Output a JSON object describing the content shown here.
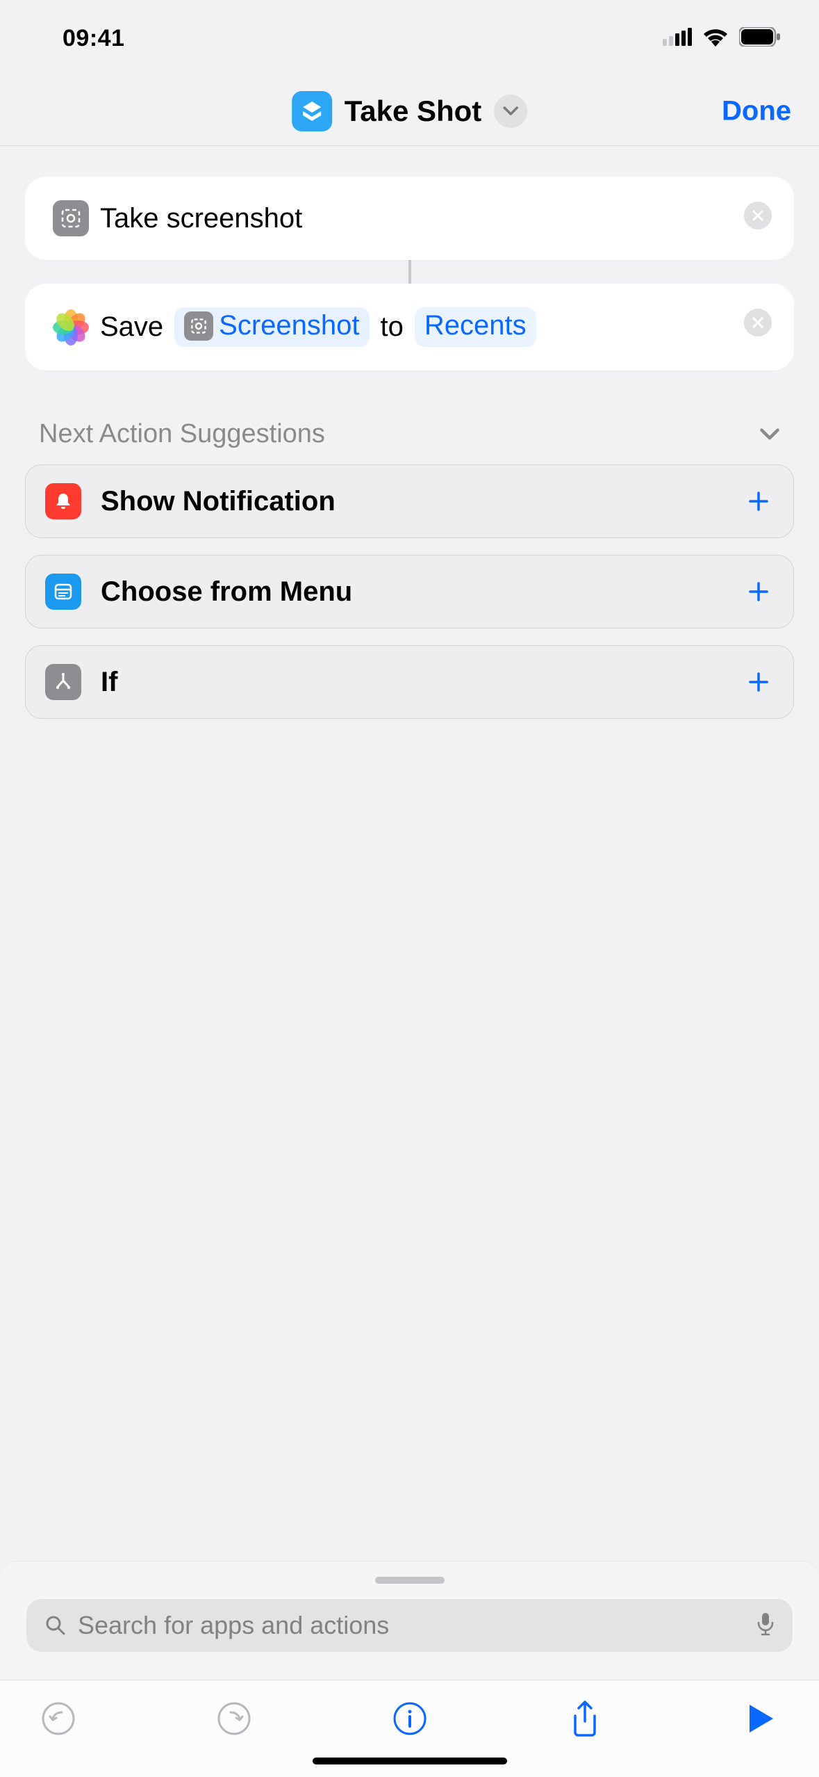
{
  "status": {
    "time": "09:41"
  },
  "header": {
    "title": "Take Shot",
    "done": "Done"
  },
  "actions": {
    "a1": {
      "label": "Take screenshot"
    },
    "a2": {
      "verb": "Save",
      "variable": "Screenshot",
      "joiner": "to",
      "dest": "Recents"
    }
  },
  "suggestions": {
    "title": "Next Action Suggestions",
    "items": {
      "0": {
        "label": "Show Notification"
      },
      "1": {
        "label": "Choose from Menu"
      },
      "2": {
        "label": "If"
      }
    }
  },
  "search": {
    "placeholder": "Search for apps and actions"
  },
  "colors": {
    "accent": "#0a67ff",
    "sugg_red": "#ff3b30",
    "sugg_blue": "#1b99ef",
    "sugg_gray": "#8e8e92"
  }
}
